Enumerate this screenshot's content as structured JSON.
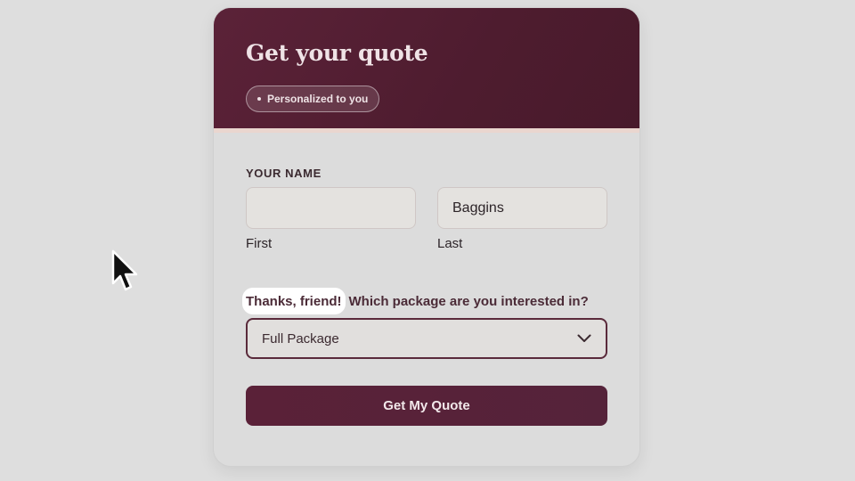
{
  "card": {
    "title": "Get your quote",
    "badge": "Personalized to you"
  },
  "name_section": {
    "label": "YOUR NAME",
    "first": {
      "value": "",
      "placeholder": "",
      "label": "First"
    },
    "last": {
      "value": "Baggins",
      "placeholder": "",
      "label": "Last"
    }
  },
  "package_section": {
    "highlight": "Thanks, friend!",
    "question": "Which package are you interested in?",
    "selected": "Full Package",
    "icon": "chevron-down-icon"
  },
  "submit": {
    "label": "Get My Quote"
  },
  "colors": {
    "brand": "#5a2138",
    "header_accent": "#ead6cf",
    "background": "#dedede"
  },
  "cursor": {
    "icon": "mouse-cursor-icon"
  }
}
